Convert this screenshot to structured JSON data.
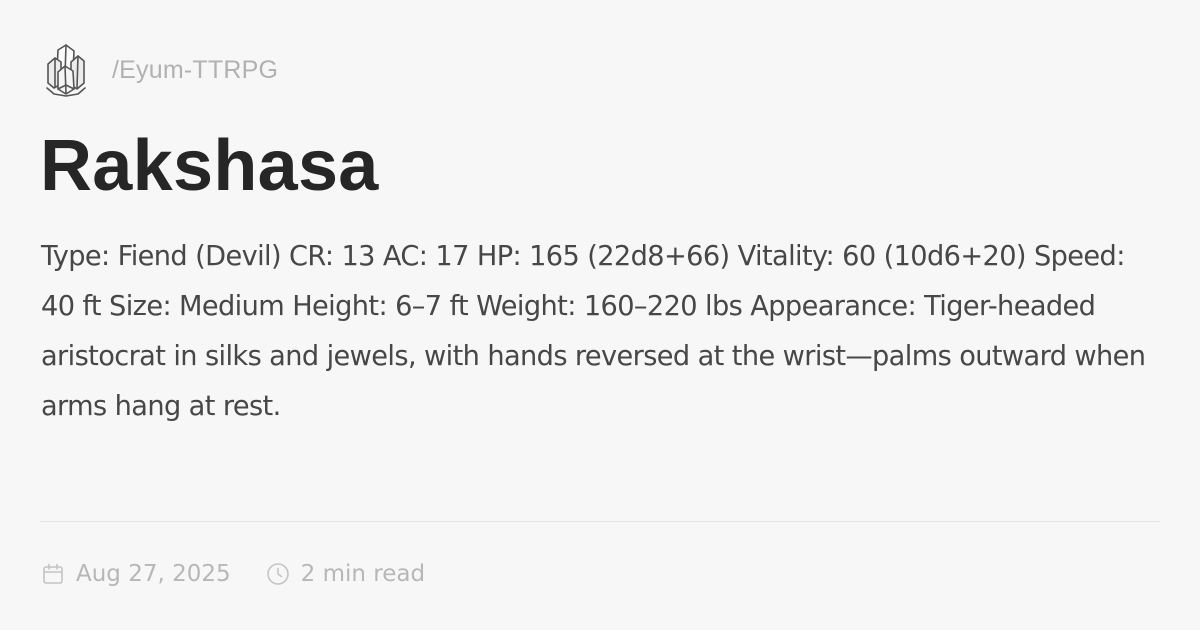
{
  "site": {
    "logo_icon": "crystal-cluster-icon",
    "path": "/Eyum-TTRPG"
  },
  "article": {
    "title": "Rakshasa",
    "description": "Type: Fiend (Devil) CR: 13 AC: 17 HP: 165 (22d8+66) Vitality: 60 (10d6+20) Speed: 40 ft Size: Medium Height: 6–7 ft Weight: 160–220 lbs Appearance: Tiger-headed aristocrat in silks and jewels, with hands reversed at the wrist—palms outward when arms hang at rest."
  },
  "meta": {
    "date_icon": "calendar-icon",
    "date": "Aug 27, 2025",
    "read_time_icon": "clock-icon",
    "read_time": "2 min read"
  },
  "colors": {
    "background": "#f8f7f8",
    "title": "#262626",
    "body_text": "#474747",
    "muted_text": "#b7b7b7",
    "divider": "#e6e5e6"
  }
}
